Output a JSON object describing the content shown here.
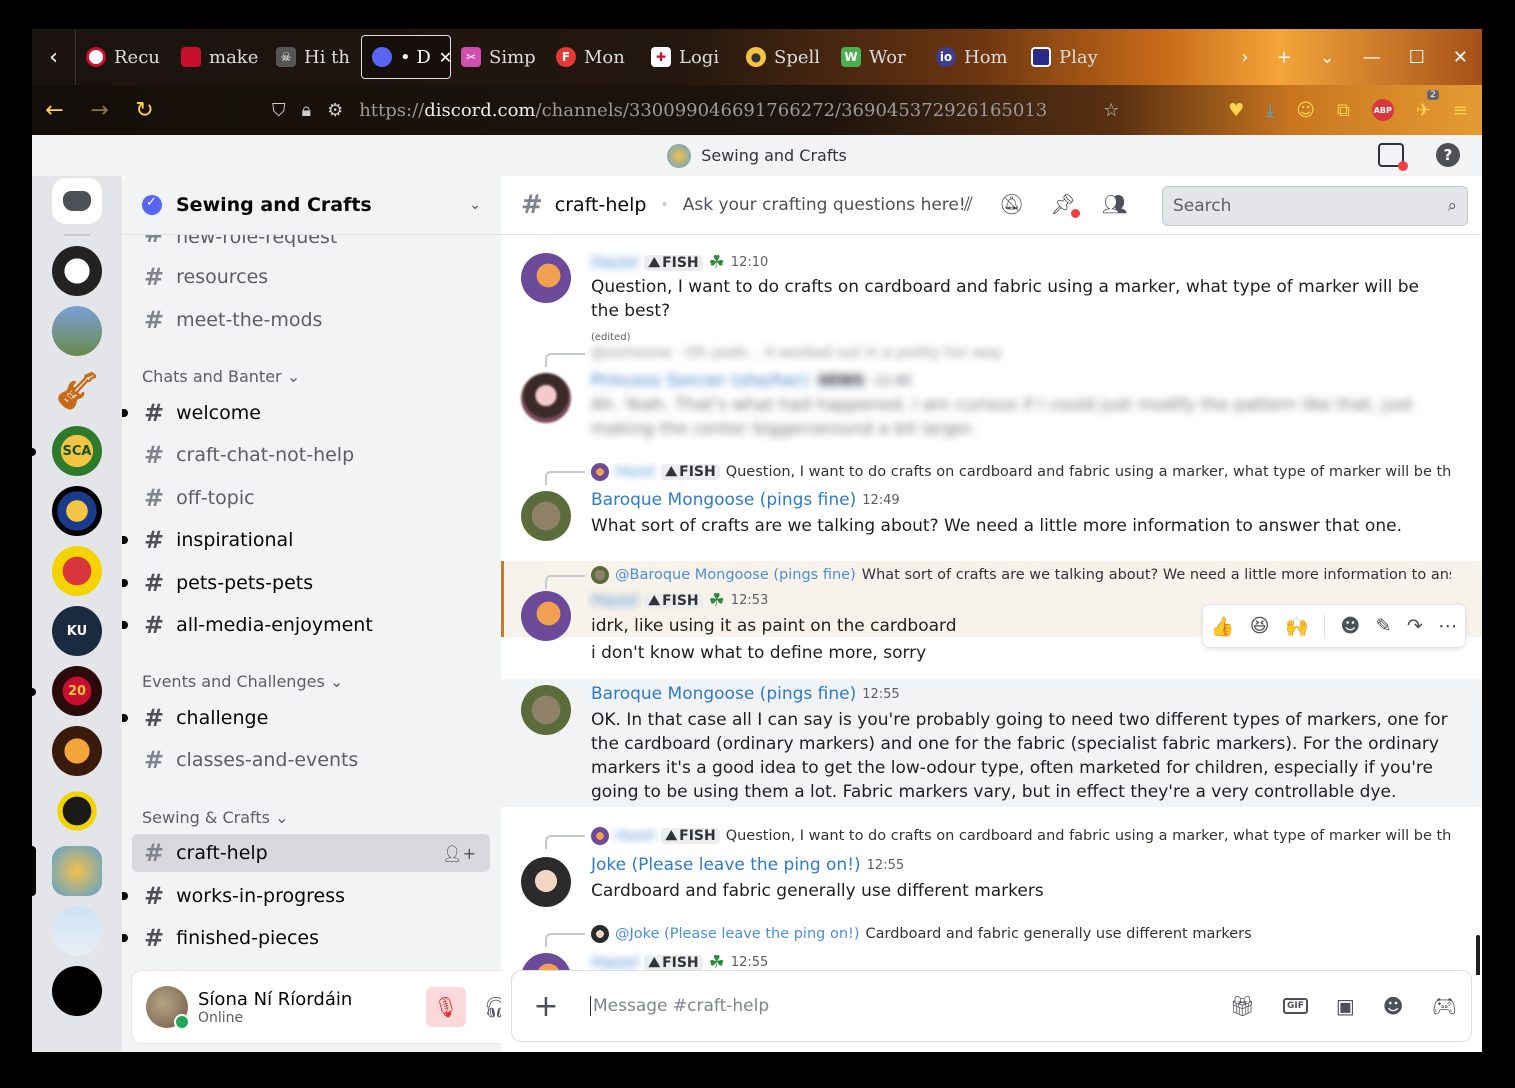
{
  "browser": {
    "tabs": [
      {
        "label": "Recu",
        "icon": "record-icon",
        "color": "#ffffff"
      },
      {
        "label": "make",
        "icon": "red-book-icon",
        "color": "#c8102e"
      },
      {
        "label": "Hi th",
        "icon": "skull-icon",
        "color": "#333333"
      },
      {
        "label": "• D",
        "icon": "discord-icon",
        "color": "#5865f2",
        "active": true
      },
      {
        "label": "Simp",
        "icon": "scissors-icon",
        "color": "#d04fb0"
      },
      {
        "label": "Mon",
        "icon": "f-icon",
        "color": "#e53935"
      },
      {
        "label": "Logi",
        "icon": "plus-icon",
        "color": "#c8102e"
      },
      {
        "label": "Spell",
        "icon": "bee-icon",
        "color": "#f4c542"
      },
      {
        "label": "Wor",
        "icon": "w-icon",
        "color": "#4caf50"
      },
      {
        "label": "Hom",
        "icon": "io-icon",
        "color": "#3d3d8f"
      },
      {
        "label": "Play",
        "icon": "grid-icon",
        "color": "#2a2a8a"
      }
    ],
    "close_tab": "✕",
    "url_prefix": "https://",
    "url_domain": "discord.com",
    "url_path": "/channels/330099046691766272/369045372926165013",
    "notification_count": "2"
  },
  "app": {
    "window_title": "Sewing and Crafts"
  },
  "sidebar": {
    "guild_name": "Sewing and Crafts",
    "channels_top": [
      {
        "name": "new-role-request",
        "unread": false
      },
      {
        "name": "resources",
        "unread": false
      },
      {
        "name": "meet-the-mods",
        "unread": false
      }
    ],
    "categories": [
      {
        "name": "Chats and Banter"
      },
      {
        "name": "Events and Challenges"
      },
      {
        "name": "Sewing & Crafts"
      }
    ],
    "chats": [
      {
        "name": "welcome",
        "unread": true
      },
      {
        "name": "craft-chat-not-help",
        "unread": false
      },
      {
        "name": "off-topic",
        "unread": false
      },
      {
        "name": "inspirational",
        "unread": true
      },
      {
        "name": "pets-pets-pets",
        "unread": true
      },
      {
        "name": "all-media-enjoyment",
        "unread": true
      }
    ],
    "events": [
      {
        "name": "challenge",
        "unread": true
      },
      {
        "name": "classes-and-events",
        "unread": false
      }
    ],
    "crafts": [
      {
        "name": "craft-help",
        "selected": true
      },
      {
        "name": "works-in-progress",
        "unread": true
      },
      {
        "name": "finished-pieces",
        "unread": true
      }
    ]
  },
  "user": {
    "name": "Síona Ní Ríordáin",
    "status": "Online"
  },
  "chat": {
    "channel": "craft-help",
    "topic": "Ask your crafting questions here!",
    "search_placeholder": "Search",
    "composer_placeholder": "Message #craft-help",
    "messages": [
      {
        "author": "Hazel",
        "tag": "FISH",
        "time": "12:10",
        "text": "Question, I want to do crafts on cardboard and fabric using a marker, what type of marker will be the best?",
        "edited": "(edited)"
      },
      {
        "reply_blurred": "@someone  · Oh yeah... it worked out in a pretty fun way",
        "author": "Princess Sorcier (she/her)",
        "tag": "SEWS",
        "time": "12:48",
        "text": "Ah. Yeah. That's what had happened. I am curious if I could just modify the pattern like that, just making the center bigger/around a bit larger."
      },
      {
        "reply_author": "Hazel",
        "reply_tag": "FISH",
        "reply_text": "Question, I want to do crafts on cardboard and fabric using a marker, what type of marker will be the b…",
        "author": "Baroque Mongoose (pings fine)",
        "time": "12:49",
        "text": "What sort of crafts are we talking about?  We need a little more information to answer that one."
      },
      {
        "reply_mention": "@Baroque Mongoose (pings fine)",
        "reply_text": "What sort of crafts are we talking about?  We need a little more information to answer t…",
        "author": "Hazel",
        "tag": "FISH",
        "time": "12:53",
        "text": "idrk, like using it as paint on the cardboard",
        "text2": "i don't know what to define more, sorry"
      },
      {
        "author": "Baroque Mongoose (pings fine)",
        "time": "12:55",
        "text": "OK.  In that case all I can say is you're probably going to need two different types of markers, one for the cardboard (ordinary markers) and one for the fabric (specialist fabric markers).  For the ordinary markers it's a good idea to get the low-odour type, often marketed for children, especially if you're going to be using them a lot.  Fabric markers vary, but in effect they're a very controllable dye."
      },
      {
        "reply_author": "Hazel",
        "reply_tag": "FISH",
        "reply_text": "Question, I want to do crafts on cardboard and fabric using a marker, what type of marker will be the b…",
        "author": "Joke (Please leave the ping on!)",
        "time": "12:55",
        "text": "Cardboard and fabric generally use different markers"
      },
      {
        "reply_mention": "@Joke (Please leave the ping on!)",
        "reply_text": "Cardboard and fabric generally use different markers",
        "author": "Hazel",
        "tag": "FISH",
        "time": "12:55"
      }
    ]
  },
  "colors": {
    "accent": "#5865f2",
    "link": "#2e7bc9",
    "online": "#23a55a",
    "danger": "#da373c"
  }
}
